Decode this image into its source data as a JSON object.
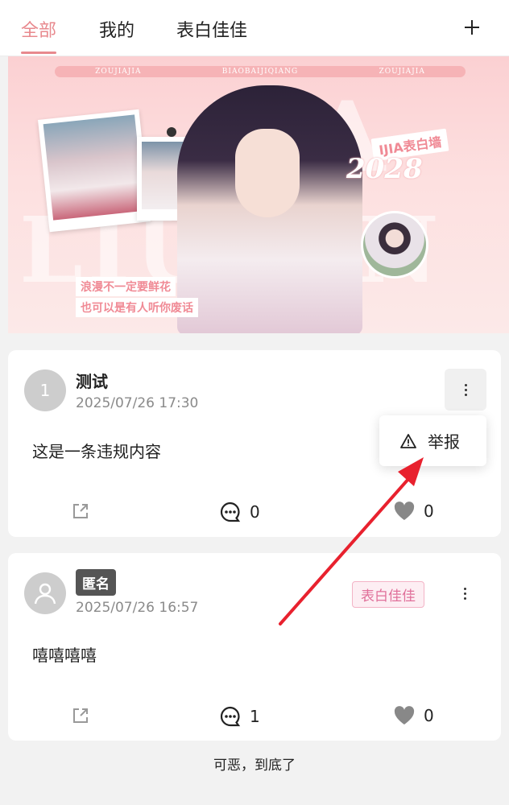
{
  "tabs": [
    {
      "label": "全部",
      "active": true
    },
    {
      "label": "我的",
      "active": false
    },
    {
      "label": "表白佳佳",
      "active": false
    }
  ],
  "colors": {
    "accent": "#e8898e",
    "tag_text": "#e0709a",
    "annotation_arrow": "#e8212e"
  },
  "banner": {
    "strip_texts": [
      "ZOUJIAJIA",
      "BIAOBAIJIQIANG",
      "ZOUJIAJIA"
    ],
    "big_text_top": "JIA",
    "big_text_bottom": "LIUYAN",
    "wall_label": "IJIA表白墙",
    "year": "2028",
    "slogan_line1": "浪漫不一定要鲜花",
    "slogan_line2": "也可以是有人听你废话"
  },
  "posts": [
    {
      "avatar_text": "1",
      "author": "测试",
      "time": "2025/07/26 17:30",
      "content": "这是一条违规内容",
      "comments": "0",
      "likes": "0"
    },
    {
      "avatar_icon": "user-icon",
      "author": "匿名",
      "time": "2025/07/26 16:57",
      "tag": "表白佳佳",
      "content": "嘻嘻嘻嘻",
      "comments": "1",
      "likes": "0"
    }
  ],
  "report_menu": {
    "label": "举报",
    "icon": "warning-icon"
  },
  "footer": "可恶，到底了"
}
